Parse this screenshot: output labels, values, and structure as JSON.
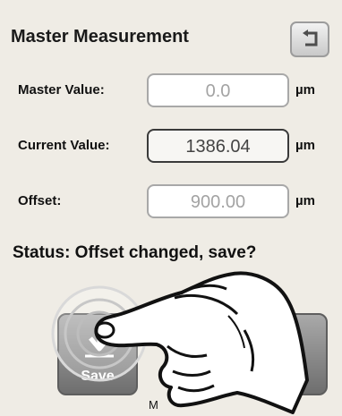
{
  "screen": {
    "title": "Master Measurement",
    "rows": [
      {
        "label": "Master Value:",
        "value": "0.0",
        "unit": "µm"
      },
      {
        "label": "Current Value:",
        "value": "1386.04",
        "unit": "µm"
      },
      {
        "label": "Offset:",
        "value": "900.00",
        "unit": "µm"
      }
    ],
    "status": "Status: Offset changed, save?",
    "save_label": "Save",
    "bottom_text": "M"
  },
  "colors": {
    "background": "#efece5",
    "button_gray": "#8a8a8a",
    "disabled_text": "#a3a3a3"
  },
  "icons": [
    "back-arrow-icon",
    "save-download-icon",
    "pointing-hand-icon"
  ]
}
